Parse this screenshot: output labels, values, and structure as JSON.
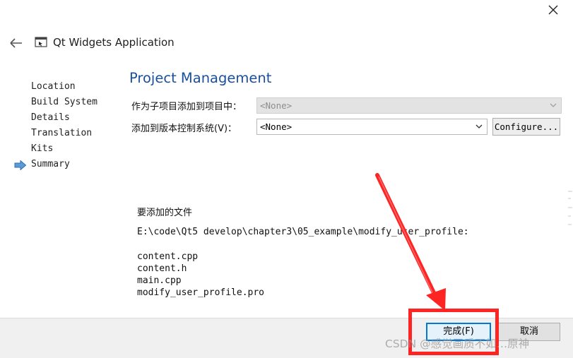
{
  "window": {
    "title": "Qt Widgets Application"
  },
  "steps": [
    {
      "label": "Location"
    },
    {
      "label": "Build System"
    },
    {
      "label": "Details"
    },
    {
      "label": "Translation"
    },
    {
      "label": "Kits"
    },
    {
      "label": "Summary",
      "current": true
    }
  ],
  "page": {
    "heading": "Project Management",
    "parent_project": {
      "label": "作为子项目添加到项目中：",
      "value": "<None>",
      "disabled": true
    },
    "version_control": {
      "label": "添加到版本控制系统(V)：",
      "value": "<None>"
    },
    "configure_button": "Configure..."
  },
  "files": {
    "heading": "要添加的文件",
    "path": "E:\\code\\Qt5 develop\\chapter3\\05_example\\modify_user_profile:",
    "items": [
      "content.cpp",
      "content.h",
      "main.cpp",
      "modify_user_profile.pro"
    ]
  },
  "buttons": {
    "finish": "完成(F)",
    "cancel": "取消"
  },
  "watermark": "CSDN @感觉画质不如…原神",
  "colors": {
    "heading": "#1a4f9c",
    "annotation": "#ff2424",
    "default_button_border": "#0078d7"
  }
}
